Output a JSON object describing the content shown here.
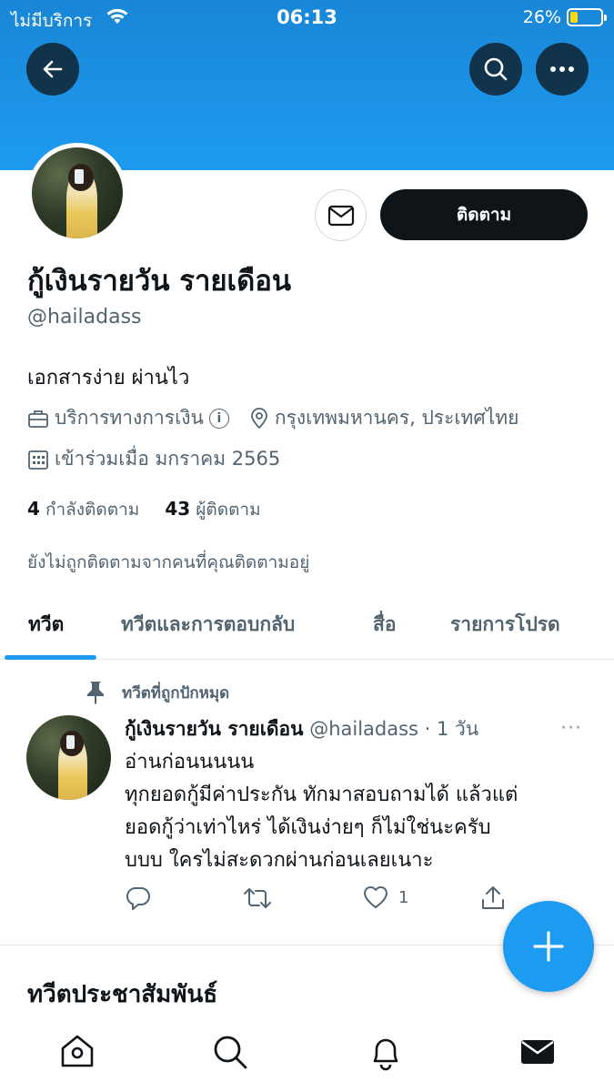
{
  "status_bar": {
    "carrier": "ไม่มีบริการ",
    "time": "06:13",
    "battery_percent": "26%"
  },
  "profile": {
    "display_name": "กู้เงินรายวัน รายเดือน",
    "handle": "@hailadass",
    "bio": "เอกสารง่าย ผ่านไว",
    "category": "บริการทางการเงิน",
    "location": "กรุงเทพมหานคร, ประเทศไทย",
    "joined": "เข้าร่วมเมื่อ มกราคม 2565",
    "following_count": "4",
    "following_label": "กำลังติดตาม",
    "followers_count": "43",
    "followers_label": "ผู้ติดตาม",
    "not_followed_note": "ยังไม่ถูกติดตามจากคนที่คุณติดตามอยู่",
    "follow_button_label": "ติดตาม"
  },
  "tabs": [
    {
      "label": "ทวีต",
      "active": true
    },
    {
      "label": "ทวีตและการตอบกลับ",
      "active": false
    },
    {
      "label": "สื่อ",
      "active": false
    },
    {
      "label": "รายการโปรด",
      "active": false
    }
  ],
  "pinned_tweet": {
    "pinned_label": "ทวีตที่ถูกปักหมุด",
    "author_name": "กู้เงินรายวัน รายเดือน",
    "author_meta": "@hailadass · 1 วัน",
    "more": "···",
    "lines": [
      "อ่านก่อนนนนน",
      "ทุกยอดกู้มีค่าประกัน ทักมาสอบถามได้ แล้วแต่",
      "ยอดกู้ว่าเท่าไหร่ ได้เงินง่ายๆ ก็ไม่ใช่นะครับ",
      "บบบ ใครไม่สะดวกผ่านก่อนเลยเนาะ"
    ],
    "like_count": "1"
  },
  "section_title": "ทวีตประชาสัมพันธ์",
  "icons": {
    "back": "arrow-left-icon",
    "search": "search-icon",
    "more": "more-horizontal-icon",
    "mail": "envelope-icon",
    "compose": "plus-icon",
    "nav": [
      "home-icon",
      "search-icon",
      "bell-icon",
      "mail-icon"
    ]
  },
  "colors": {
    "accent": "#1d9bf0",
    "text_primary": "#0f1419",
    "text_secondary": "#536471"
  }
}
